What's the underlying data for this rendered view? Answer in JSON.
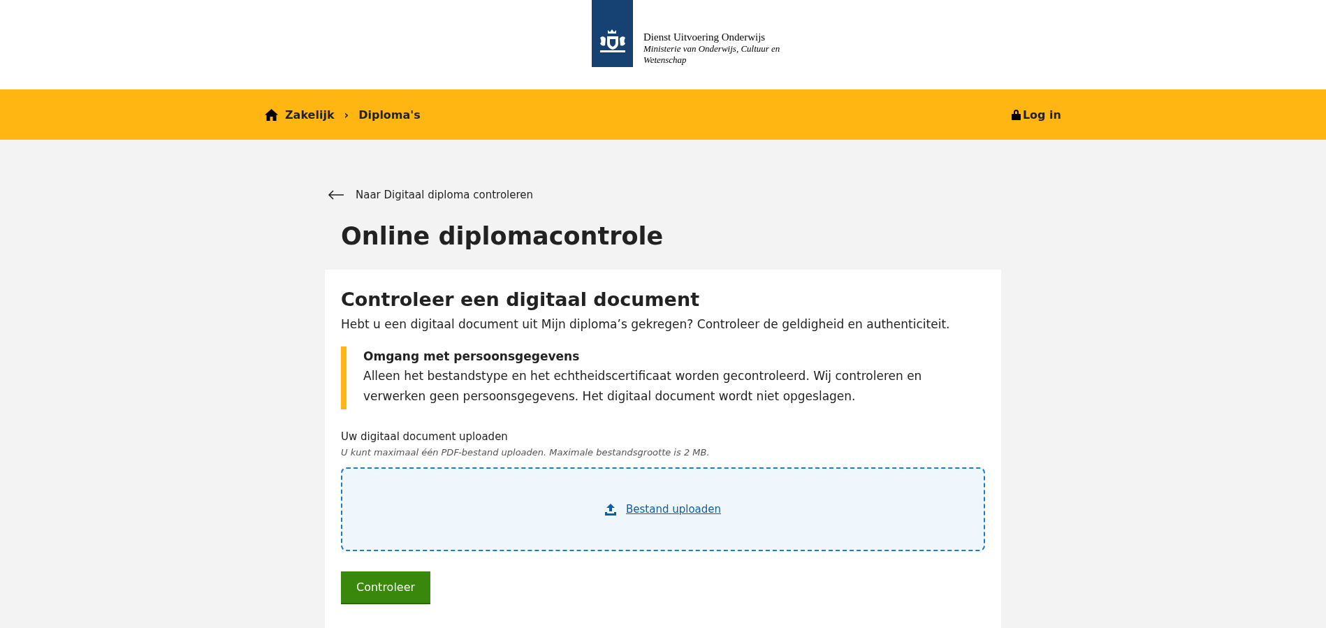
{
  "header": {
    "logo": {
      "org": "Dienst Uitvoering Onderwijs",
      "ministry": "Ministerie van Onderwijs, Cultuur en Wetenschap"
    }
  },
  "nav": {
    "breadcrumbs": [
      "Zakelijk",
      "Diploma's"
    ],
    "separator": "›",
    "login": "Log in"
  },
  "back_link": "Naar Digitaal diploma controleren",
  "page_title": "Online diplomacontrole",
  "card": {
    "title": "Controleer een digitaal document",
    "intro": "Hebt u een digitaal document uit Mijn diploma’s gekregen? Controleer de geldigheid en authenticiteit.",
    "notice": {
      "title": "Omgang met persoonsgegevens",
      "text": "Alleen het bestandstype en het echtheidscertificaat worden gecontroleerd. Wij controleren en verwerken geen persoonsgegevens. Het digitaal document wordt niet opgeslagen."
    },
    "upload": {
      "label": "Uw digitaal document uploaden",
      "hint": "U kunt maximaal één PDF-bestand uploaden. Maximale bestandsgrootte is 2 MB.",
      "link": "Bestand uploaden"
    },
    "submit": "Controleer"
  }
}
